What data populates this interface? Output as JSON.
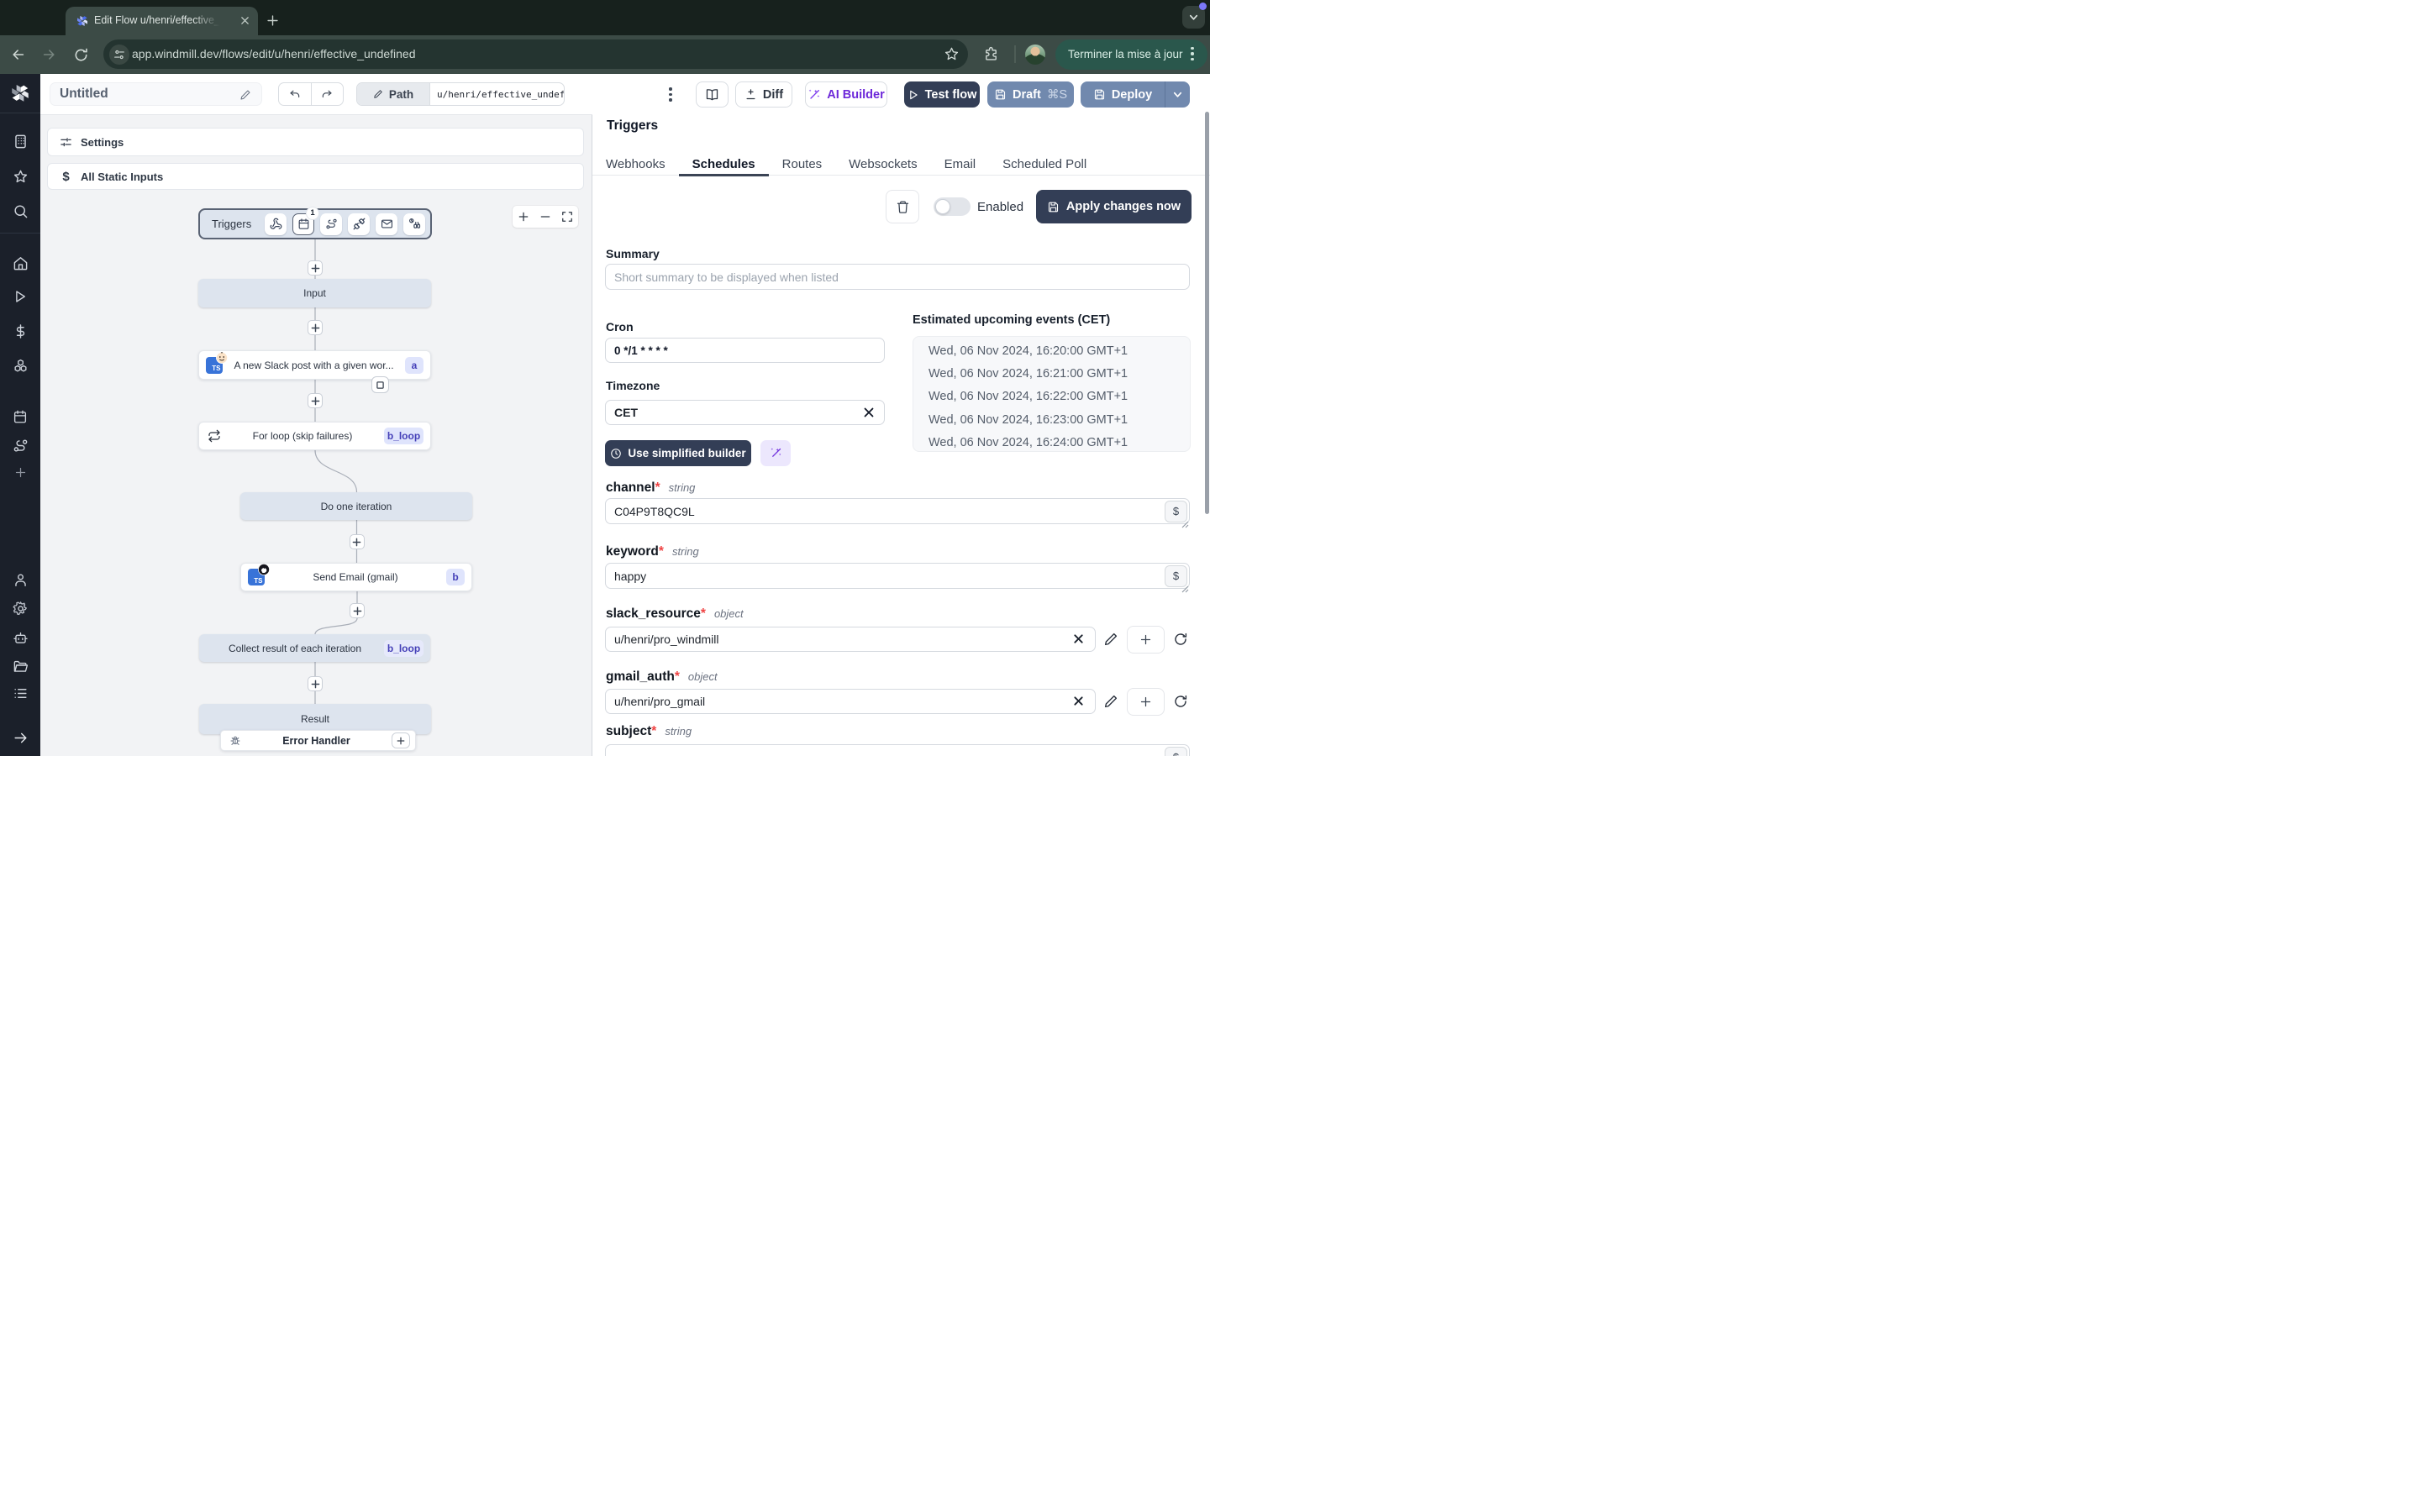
{
  "browser": {
    "tab_title": "Edit Flow u/henri/effective_un",
    "url": "app.windmill.dev/flows/edit/u/henri/effective_undefined",
    "update_button": "Terminer la mise à jour"
  },
  "topbar": {
    "flow_name": "Untitled",
    "path_label": "Path",
    "path_value": "u/henri/effective_undef",
    "diff_label": "Diff",
    "ai_builder_label": "AI Builder",
    "test_flow_label": "Test flow",
    "draft_label": "Draft",
    "draft_shortcut": "⌘S",
    "deploy_label": "Deploy"
  },
  "canvas": {
    "settings_label": "Settings",
    "static_inputs_label": "All Static Inputs",
    "static_inputs_icon": "$",
    "triggers_label": "Triggers",
    "schedule_badge": "1",
    "nodes": {
      "input": "Input",
      "slack": "A new Slack post with a given wor...",
      "slack_badge": "a",
      "forloop": "For loop (skip failures)",
      "forloop_badge": "b_loop",
      "iteration": "Do one iteration",
      "email": "Send Email (gmail)",
      "email_badge": "b",
      "collect": "Collect result of each iteration",
      "collect_badge": "b_loop",
      "result": "Result",
      "error_handler": "Error Handler",
      "ts_label": "TS"
    }
  },
  "panel": {
    "title": "Triggers",
    "tabs": [
      "Webhooks",
      "Schedules",
      "Routes",
      "Websockets",
      "Email",
      "Scheduled Poll"
    ],
    "enabled_label": "Enabled",
    "apply_label": "Apply changes now",
    "summary_label": "Summary",
    "summary_placeholder": "Short summary to be displayed when listed",
    "cron_label": "Cron",
    "cron_value": "0 */1 * * * *",
    "timezone_label": "Timezone",
    "timezone_value": "CET",
    "builder_label": "Use simplified builder",
    "events_title": "Estimated upcoming events (CET)",
    "events": [
      "Wed, 06 Nov 2024, 16:20:00 GMT+1",
      "Wed, 06 Nov 2024, 16:21:00 GMT+1",
      "Wed, 06 Nov 2024, 16:22:00 GMT+1",
      "Wed, 06 Nov 2024, 16:23:00 GMT+1",
      "Wed, 06 Nov 2024, 16:24:00 GMT+1"
    ],
    "dollar": "$",
    "fields": {
      "channel": {
        "name": "channel",
        "required": "*",
        "type": "string",
        "value": "C04P9T8QC9L"
      },
      "keyword": {
        "name": "keyword",
        "required": "*",
        "type": "string",
        "value": "happy"
      },
      "slack_resource": {
        "name": "slack_resource",
        "required": "*",
        "type": "object",
        "value": "u/henri/pro_windmill"
      },
      "gmail_auth": {
        "name": "gmail_auth",
        "required": "*",
        "type": "object",
        "value": "u/henri/pro_gmail"
      },
      "subject": {
        "name": "subject",
        "required": "*",
        "type": "string",
        "value": ""
      }
    }
  },
  "colors": {
    "dark_button": "#333e56",
    "slate_button": "#7189ae",
    "badge_bg": "#dfe4fc",
    "badge_text": "#4540b8",
    "ai_purple": "#6d28d9",
    "update_pill": "#2a574c",
    "node_gray": "#dde4ee"
  }
}
